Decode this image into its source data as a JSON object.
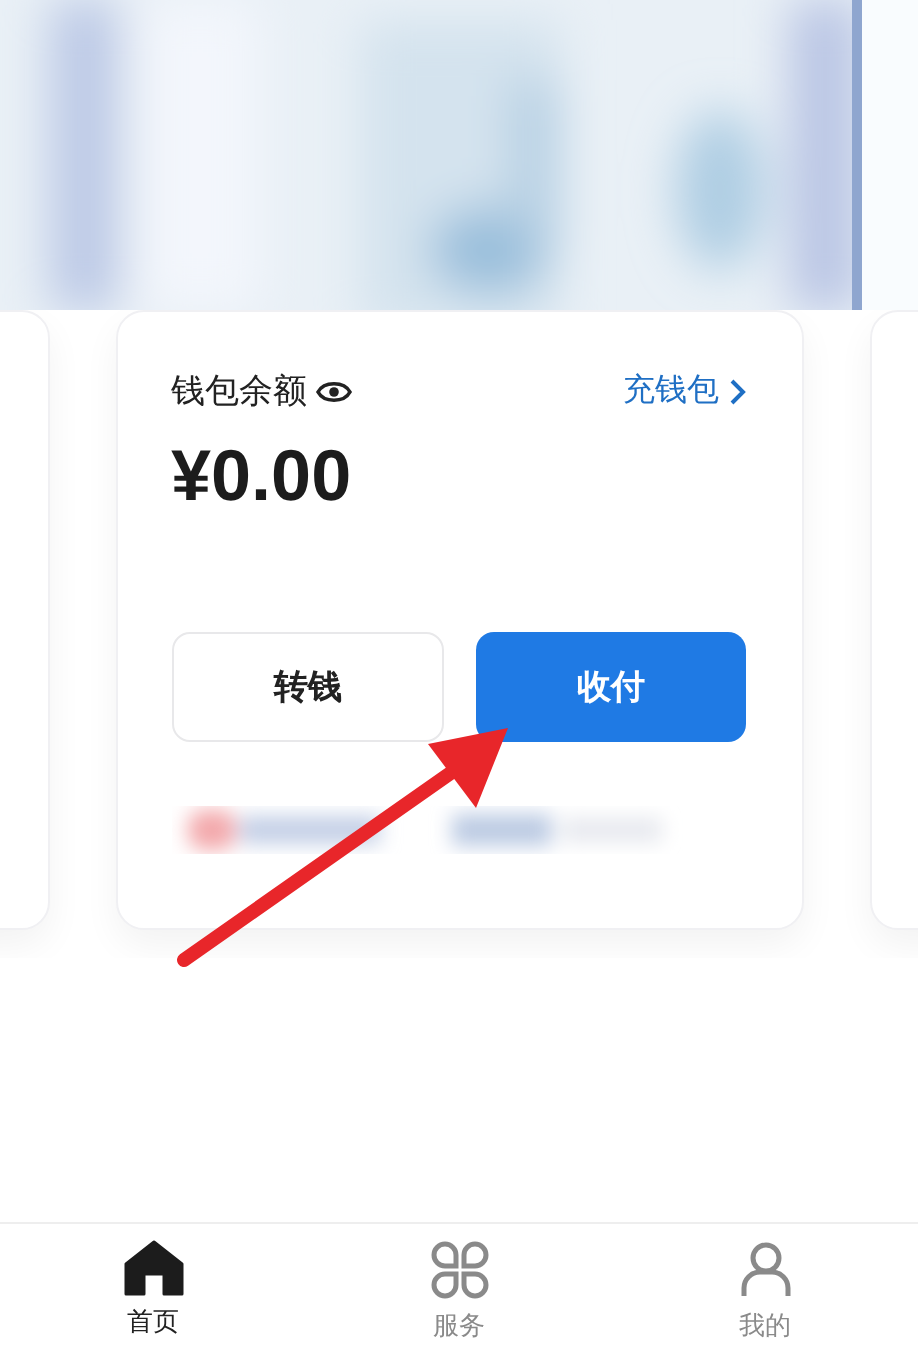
{
  "wallet_card": {
    "title": "钱包余额",
    "top_up_link": "充钱包",
    "balance": "¥0.00",
    "buttons": [
      {
        "label": "转钱",
        "kind": "secondary"
      },
      {
        "label": "收付",
        "kind": "primary"
      }
    ]
  },
  "annotation": {
    "kind": "arrow"
  },
  "tab_bar": [
    {
      "label": "首页",
      "kind": "home",
      "selected": true
    },
    {
      "label": "服务",
      "kind": "services",
      "selected": false
    },
    {
      "label": "我的",
      "kind": "profile",
      "selected": false
    }
  ]
}
